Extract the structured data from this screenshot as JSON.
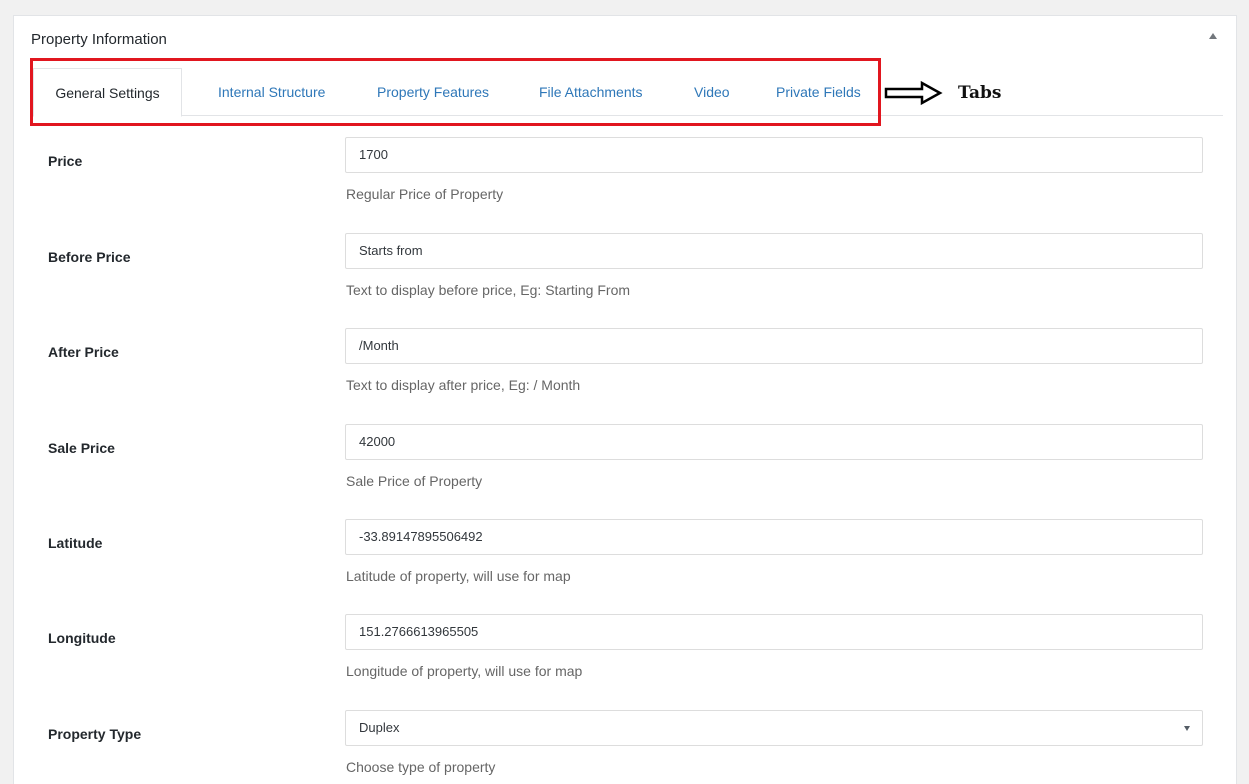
{
  "metabox": {
    "title": "Property Information",
    "toggle_icon": "triangle-up-icon"
  },
  "tabs": [
    {
      "label": "General Settings",
      "active": true
    },
    {
      "label": "Internal Structure",
      "active": false
    },
    {
      "label": "Property Features",
      "active": false
    },
    {
      "label": "File Attachments",
      "active": false
    },
    {
      "label": "Video",
      "active": false
    },
    {
      "label": "Private Fields",
      "active": false
    }
  ],
  "annotation": {
    "label": "Tabs",
    "icon": "right-arrow-icon",
    "highlight_color": "#e1161f"
  },
  "fields": [
    {
      "label": "Price",
      "value": "1700",
      "description": "Regular Price of Property"
    },
    {
      "label": "Before Price",
      "value": "Starts from",
      "description": "Text to display before price, Eg: Starting From"
    },
    {
      "label": "After Price",
      "value": "/Month",
      "description": "Text to display after price, Eg: / Month"
    },
    {
      "label": "Sale Price",
      "value": "42000",
      "description": "Sale Price of Property"
    },
    {
      "label": "Latitude",
      "value": "-33.89147895506492",
      "description": "Latitude of property, will use for map"
    },
    {
      "label": "Longitude",
      "value": "151.2766613965505",
      "description": "Longitude of property, will use for map"
    },
    {
      "label": "Property Type",
      "value": "Duplex",
      "description": "Choose type of property"
    }
  ],
  "colors": {
    "link": "#2e77b8",
    "text": "#23282d",
    "description": "#666666",
    "border": "#dddddd"
  }
}
